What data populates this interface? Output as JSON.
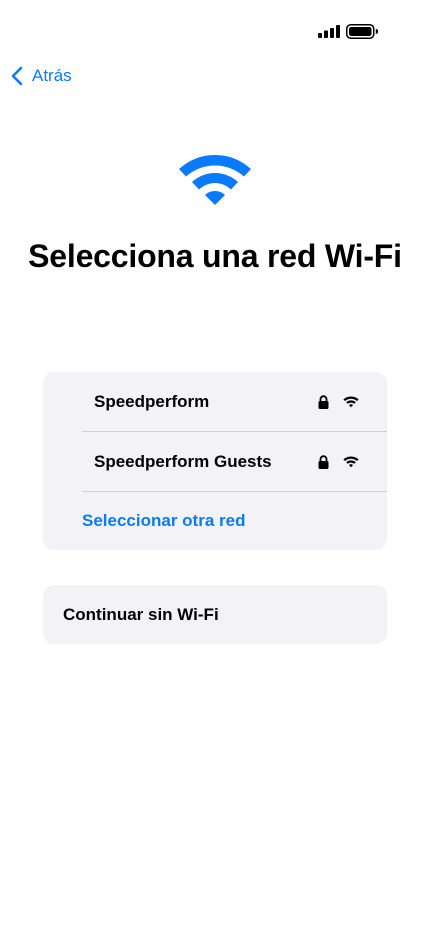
{
  "status_bar": {
    "signal_icon": "cellular-signal-icon",
    "battery_icon": "battery-icon"
  },
  "nav": {
    "back_label": "Atrás"
  },
  "header": {
    "icon": "wifi-icon",
    "title": "Selecciona una red Wi-Fi"
  },
  "networks": [
    {
      "name": "Speedperform",
      "secured": true
    },
    {
      "name": "Speedperform Guests",
      "secured": true
    }
  ],
  "other_network_label": "Seleccionar otra red",
  "continue_without_wifi_label": "Continuar sin Wi-Fi",
  "colors": {
    "accent": "#0a7aff",
    "card_background": "#f2f2f7",
    "text": "#000000"
  }
}
